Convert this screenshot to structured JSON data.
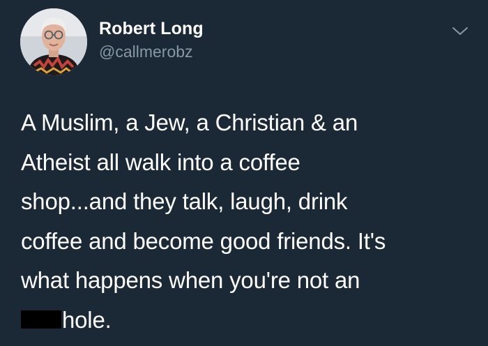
{
  "user": {
    "display_name": "Robert Long",
    "handle": "@callmerobz"
  },
  "tweet": {
    "lines": [
      "A Muslim, a Jew, a Christian & an",
      "Atheist all walk into a coffee",
      "shop...and they talk, laugh, drink",
      "coffee and become good friends.  It's",
      "what happens when you're not an"
    ],
    "last_line_after_redaction": "hole."
  },
  "icons": {
    "avatar": "profile-photo",
    "menu": "chevron-down-icon"
  },
  "colors": {
    "background": "#1b2836",
    "text": "#ffffff",
    "secondary_text": "#8899a6"
  }
}
